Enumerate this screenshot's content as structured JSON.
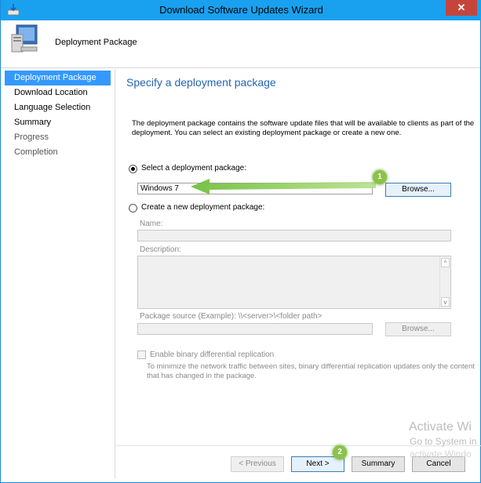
{
  "window": {
    "title": "Download Software Updates Wizard",
    "close_glyph": "✕"
  },
  "header": {
    "title": "Deployment Package",
    "icon": "computer-icon"
  },
  "sidebar": {
    "items": [
      {
        "label": "Deployment Package",
        "state": "active"
      },
      {
        "label": "Download Location",
        "state": "normal"
      },
      {
        "label": "Language Selection",
        "state": "normal"
      },
      {
        "label": "Summary",
        "state": "normal"
      },
      {
        "label": "Progress",
        "state": "dim"
      },
      {
        "label": "Completion",
        "state": "dim"
      }
    ]
  },
  "main": {
    "title": "Specify a deployment package",
    "description": "The deployment package contains the software update files that will be available to clients as part of the deployment. You can select an existing deployment package or create a new one.",
    "select_option": {
      "label": "Select a deployment package:",
      "selected": true,
      "value": "Windows 7",
      "browse_label": "Browse..."
    },
    "create_option": {
      "label": "Create a new deployment package:",
      "selected": false,
      "name_label": "Name:",
      "description_label": "Description:",
      "source_label": "Package source (Example): \\\\<server>\\<folder path>",
      "browse_label": "Browse...",
      "scroll_up": "^",
      "scroll_down": "v"
    },
    "binary_replication": {
      "label": "Enable binary differential replication",
      "checked": false,
      "note_line1": "To minimize the network traffic between sites, binary differential replication updates only the content",
      "note_line2": "that has changed in the package."
    }
  },
  "footer": {
    "previous_label": "< Previous",
    "next_label": "Next >",
    "summary_label": "Summary",
    "cancel_label": "Cancel"
  },
  "callouts": {
    "one": "1",
    "two": "2"
  },
  "watermark": {
    "line1": "Activate Wi",
    "line2": "Go to System in",
    "line3": "activate Windo"
  },
  "colors": {
    "titlebar": "#19a1f0",
    "accent": "#3399ff",
    "heading": "#2566b1",
    "callout": "#8bc34a",
    "close": "#c6453a"
  }
}
